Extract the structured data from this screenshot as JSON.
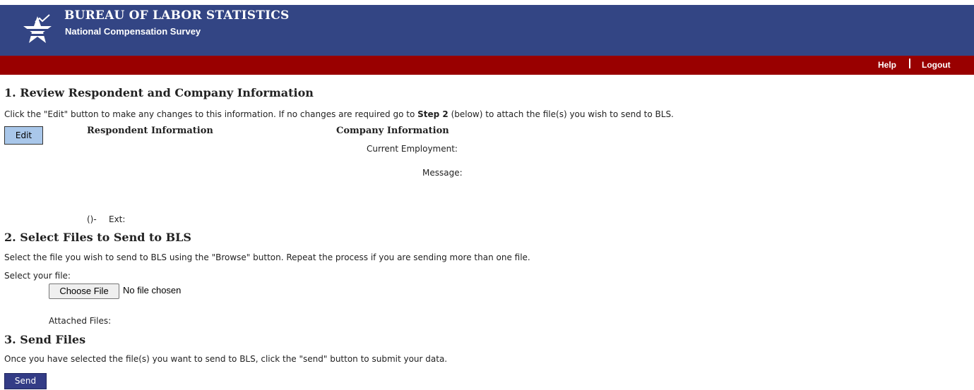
{
  "header": {
    "title": "BUREAU OF LABOR STATISTICS",
    "subtitle": "National Compensation Survey",
    "logo_icon": "bls-star-logo-icon",
    "bg_color": "#334584"
  },
  "nav": {
    "help": "Help",
    "logout": "Logout",
    "bar_color": "#990000"
  },
  "step1": {
    "heading": "1. Review Respondent and Company Information",
    "desc_pre": "Click the \"Edit\" button to make any changes to this information. If no changes are required go to ",
    "desc_bold": "Step 2",
    "desc_post": " (below) to attach the file(s) you wish to send to BLS.",
    "edit_label": "Edit",
    "respondent_heading": "Respondent Information",
    "company_heading": "Company Information",
    "current_employment_label": "Current Employment:",
    "message_label": "Message:",
    "phone_text": "()-",
    "ext_label": "Ext:"
  },
  "step2": {
    "heading": "2. Select Files to Send to BLS",
    "desc": "Select the file you wish to send to BLS using the \"Browse\" button. Repeat the process if you are sending more than one file.",
    "select_label": "Select your file:",
    "choose_file_label": "Choose File",
    "no_file_text": "No file chosen",
    "attached_label": "Attached Files:"
  },
  "step3": {
    "heading": "3. Send Files",
    "desc": "Once you have selected the file(s) you want to send to BLS, click the \"send\" button to submit your data.",
    "send_label": "Send"
  }
}
